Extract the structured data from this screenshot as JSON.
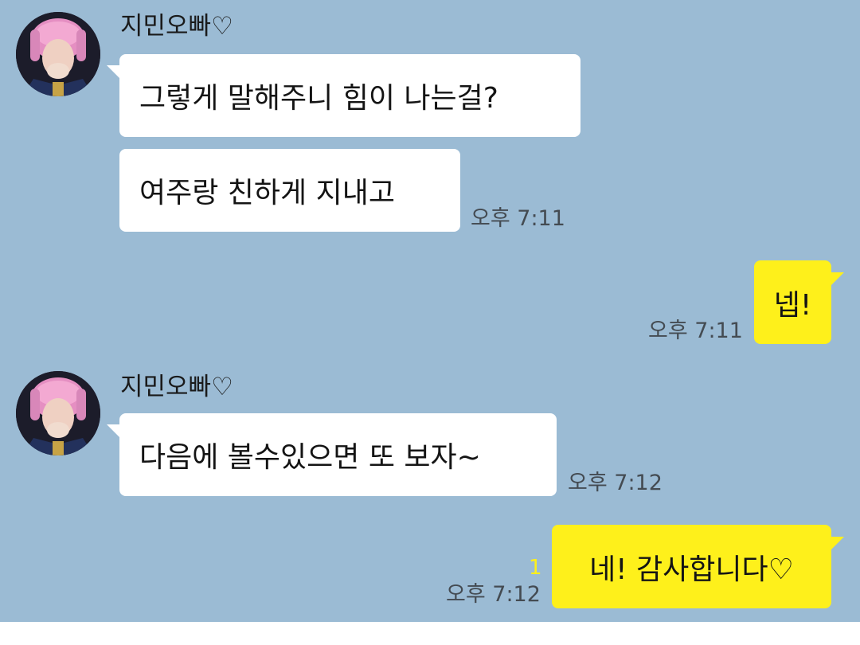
{
  "chat": {
    "sender_name": "지민오빠♡",
    "avatar_icon": "profile-photo-avatar",
    "colors": {
      "background": "#9bbbd4",
      "incoming_bubble": "#ffffff",
      "outgoing_bubble": "#fef01b",
      "timestamp": "#444b52"
    },
    "messages": [
      {
        "direction": "incoming",
        "text": "그렇게 말해주니 힘이 나는걸?"
      },
      {
        "direction": "incoming",
        "text": "여주랑 친하게 지내고",
        "time": "오후 7:11"
      },
      {
        "direction": "outgoing",
        "text": "넵!",
        "time": "오후 7:11"
      },
      {
        "direction": "incoming",
        "text": "다음에 볼수있으면 또 보자~",
        "time": "오후 7:12"
      },
      {
        "direction": "outgoing",
        "text": "네! 감사합니다♡",
        "time": "오후 7:12",
        "unread_count": "1"
      }
    ]
  }
}
